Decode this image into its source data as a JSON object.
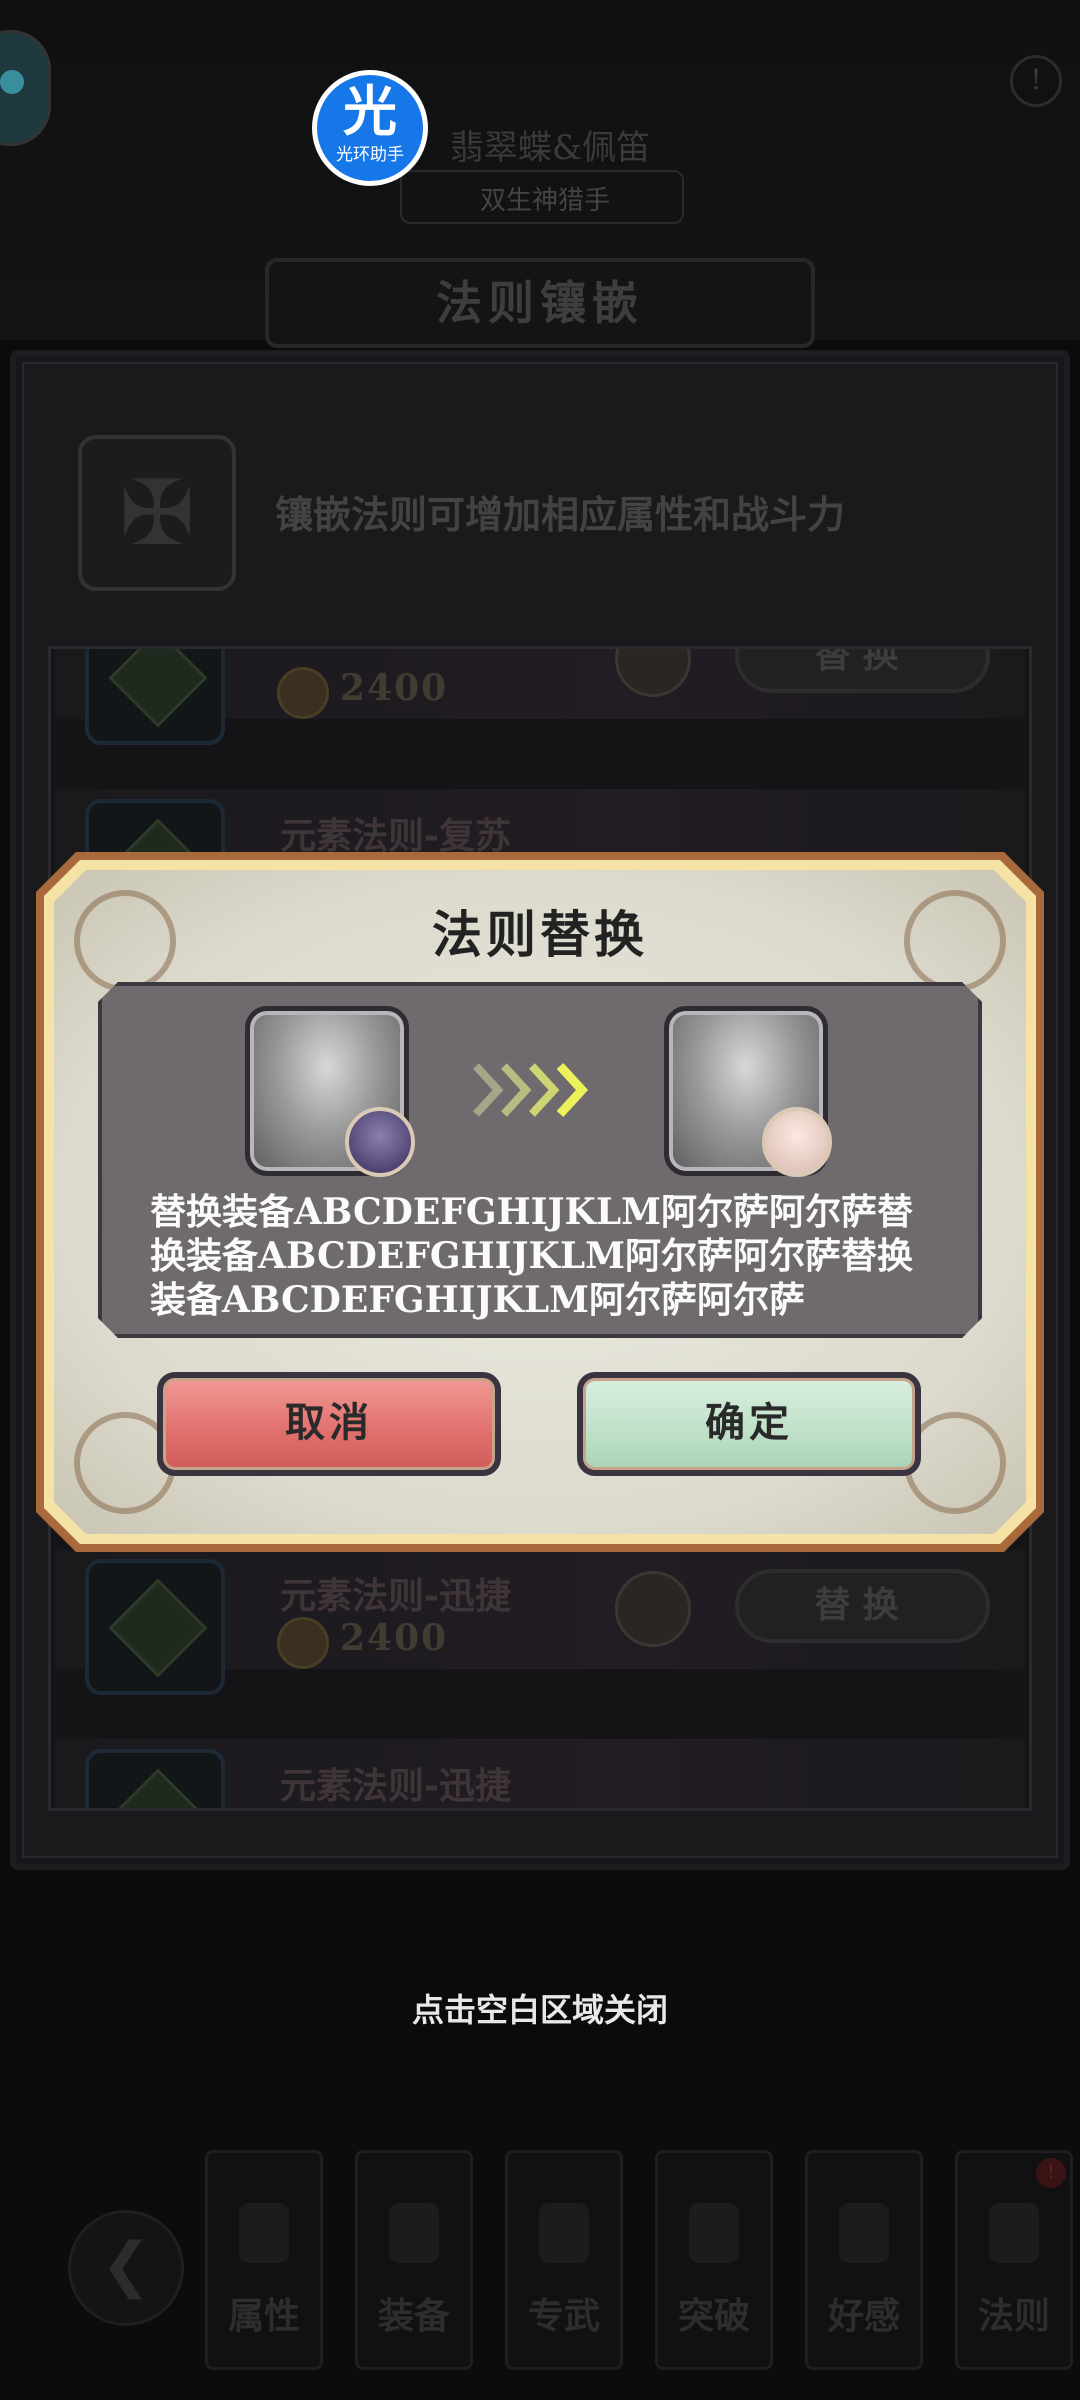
{
  "background": {
    "header_title": "翡翠蝶&佩笛",
    "header_subtitle": "双生神猎手",
    "panel_title": "法则镶嵌",
    "inlay_description": "镶嵌法则可增加相应属性和战斗力",
    "rows": [
      {
        "name": "",
        "cost": "2400",
        "button": "替换"
      },
      {
        "name": "元素法则-复苏",
        "cost": "",
        "button": ""
      },
      {
        "name": "元素法则-迅捷",
        "cost": "2400",
        "button": "替换"
      },
      {
        "name": "元素法则-迅捷",
        "cost": "",
        "button": ""
      }
    ]
  },
  "helper_badge": {
    "char": "光",
    "label": "光环助手"
  },
  "modal": {
    "title": "法则替换",
    "description": "替换装备ABCDEFGHIJKLM阿尔萨阿尔萨替换装备ABCDEFGHIJKLM阿尔萨阿尔萨替换装备ABCDEFGHIJKLM阿尔萨阿尔萨",
    "cancel_label": "取消",
    "confirm_label": "确定"
  },
  "close_hint": "点击空白区域关闭",
  "tabs": [
    {
      "label": "属性"
    },
    {
      "label": "装备"
    },
    {
      "label": "专武"
    },
    {
      "label": "突破"
    },
    {
      "label": "好感"
    },
    {
      "label": "法则"
    }
  ],
  "colors": {
    "cancel": "#e07a76",
    "confirm": "#c6e6cf",
    "modal_border": "#a86a3a",
    "arrow": "#e8f060"
  },
  "icons": {
    "back": "back-arrow-icon",
    "inlay": "cross-icon",
    "arrow": "chevrons-right-icon"
  }
}
